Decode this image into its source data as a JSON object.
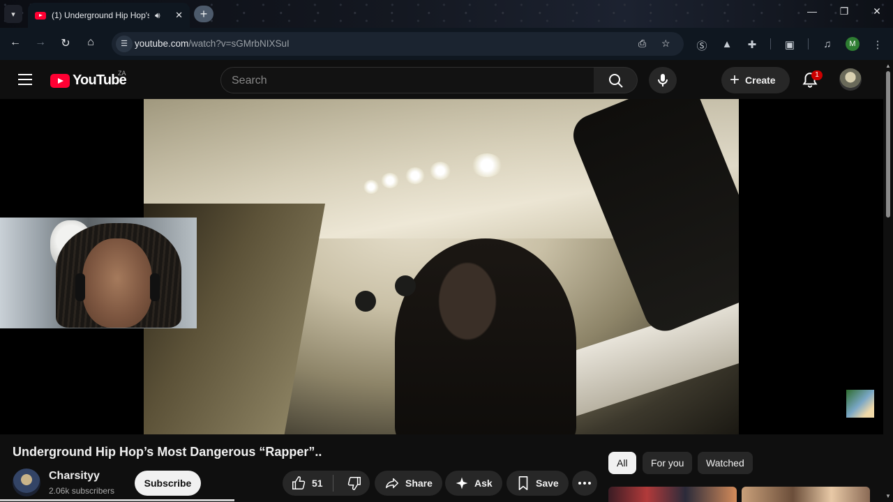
{
  "browser": {
    "tab_title": "(1) Underground Hip Hop's",
    "url_host": "youtube.com",
    "url_path": "/watch?v=sGMrbNIXSuI",
    "profile_initial": "M"
  },
  "masthead": {
    "logo_text": "YouTube",
    "country_code": "ZA",
    "search_placeholder": "Search",
    "create_label": "Create",
    "notification_count": "1"
  },
  "video": {
    "title": "Underground Hip Hop’s Most Dangerous “Rapper”..",
    "channel_name": "Charsityy",
    "subscribers": "2.06k subscribers",
    "subscribe_label": "Subscribe",
    "like_count": "51",
    "share_label": "Share",
    "ask_label": "Ask",
    "save_label": "Save"
  },
  "chips": [
    {
      "label": "All"
    },
    {
      "label": "For you"
    },
    {
      "label": "Watched"
    }
  ],
  "colors": {
    "yt_red": "#ff0033",
    "page_bg": "#0f0f0f",
    "pill_bg": "#272727"
  }
}
